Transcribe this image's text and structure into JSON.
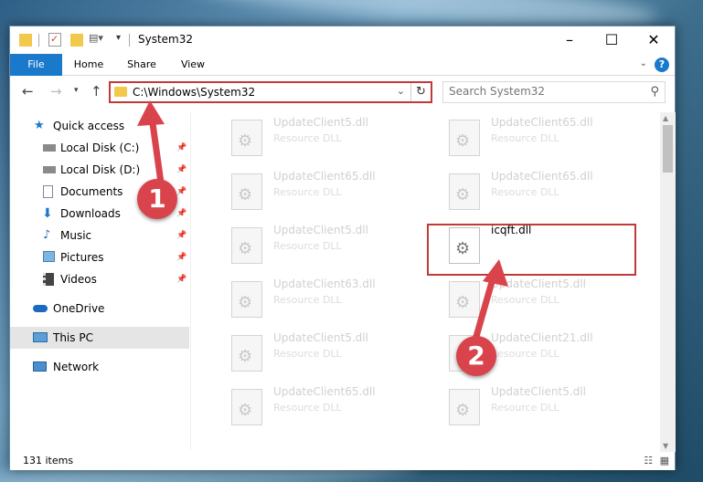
{
  "window": {
    "title": "System32"
  },
  "ribbon": {
    "tabs": [
      "File",
      "Home",
      "Share",
      "View"
    ],
    "help": "?"
  },
  "address": {
    "path": "C:\\Windows\\System32"
  },
  "search": {
    "placeholder": "Search System32"
  },
  "sidebar": {
    "items": [
      {
        "label": "Quick access",
        "icon": "star-icon",
        "pinned": false
      },
      {
        "label": "Local Disk (C:)",
        "icon": "drive-icon",
        "pinned": true
      },
      {
        "label": "Local Disk (D:)",
        "icon": "drive-icon",
        "pinned": true
      },
      {
        "label": "Documents",
        "icon": "documents-icon",
        "pinned": true
      },
      {
        "label": "Downloads",
        "icon": "downloads-icon",
        "pinned": true
      },
      {
        "label": "Music",
        "icon": "music-icon",
        "pinned": true
      },
      {
        "label": "Pictures",
        "icon": "pictures-icon",
        "pinned": true
      },
      {
        "label": "Videos",
        "icon": "videos-icon",
        "pinned": true
      },
      {
        "label": "OneDrive",
        "icon": "onedrive-icon",
        "pinned": false
      },
      {
        "label": "This PC",
        "icon": "pc-icon",
        "pinned": false,
        "selected": true
      },
      {
        "label": "Network",
        "icon": "network-icon",
        "pinned": false
      }
    ]
  },
  "files": [
    {
      "name": "UpdateClient5.dll",
      "type": "Resource DLL"
    },
    {
      "name": "UpdateClient65.dll",
      "type": "Resource DLL"
    },
    {
      "name": "UpdateClient65.dll",
      "type": "Resource DLL"
    },
    {
      "name": "UpdateClient65.dll",
      "type": "Resource DLL"
    },
    {
      "name": "UpdateClient5.dll",
      "type": "Resource DLL"
    },
    {
      "name": "icqft.dll",
      "type": "",
      "highlighted": true
    },
    {
      "name": "UpdateClient63.dll",
      "type": "Resource DLL"
    },
    {
      "name": "UpdateClient5.dll",
      "type": "Resource DLL"
    },
    {
      "name": "UpdateClient5.dll",
      "type": "Resource DLL"
    },
    {
      "name": "UpdateClient21.dll",
      "type": "Resource DLL"
    },
    {
      "name": "UpdateClient65.dll",
      "type": "Resource DLL"
    },
    {
      "name": "UpdateClient5.dll",
      "type": "Resource DLL"
    }
  ],
  "status": {
    "count": "131 items"
  },
  "annotations": [
    {
      "number": "1",
      "color": "#d9434b"
    },
    {
      "number": "2",
      "color": "#d9434b"
    }
  ]
}
